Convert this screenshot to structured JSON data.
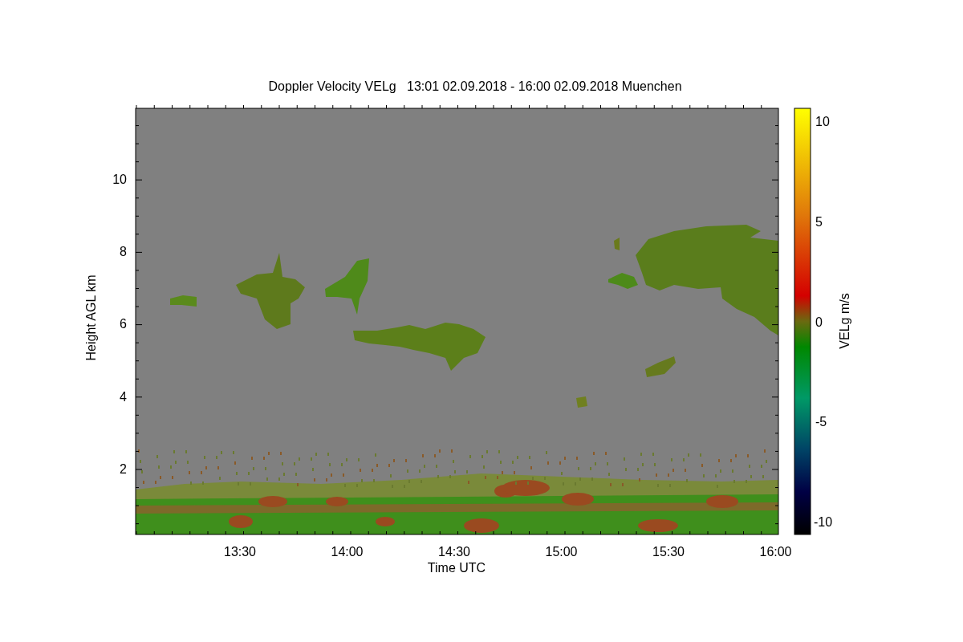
{
  "title": "Doppler Velocity VELg   13:01 02.09.2018 - 16:00 02.09.2018 Muenchen",
  "y_axis": {
    "label": "Height AGL km",
    "ticks": [
      "10",
      "8",
      "6",
      "4",
      "2"
    ]
  },
  "x_axis": {
    "label": "Time UTC",
    "ticks": [
      "13:30",
      "14:00",
      "14:30",
      "15:00",
      "15:30",
      "16:00"
    ]
  },
  "colorbar": {
    "label": "VELg m/s",
    "ticks": [
      "10",
      "5",
      "0",
      "-5",
      "-10"
    ]
  }
}
